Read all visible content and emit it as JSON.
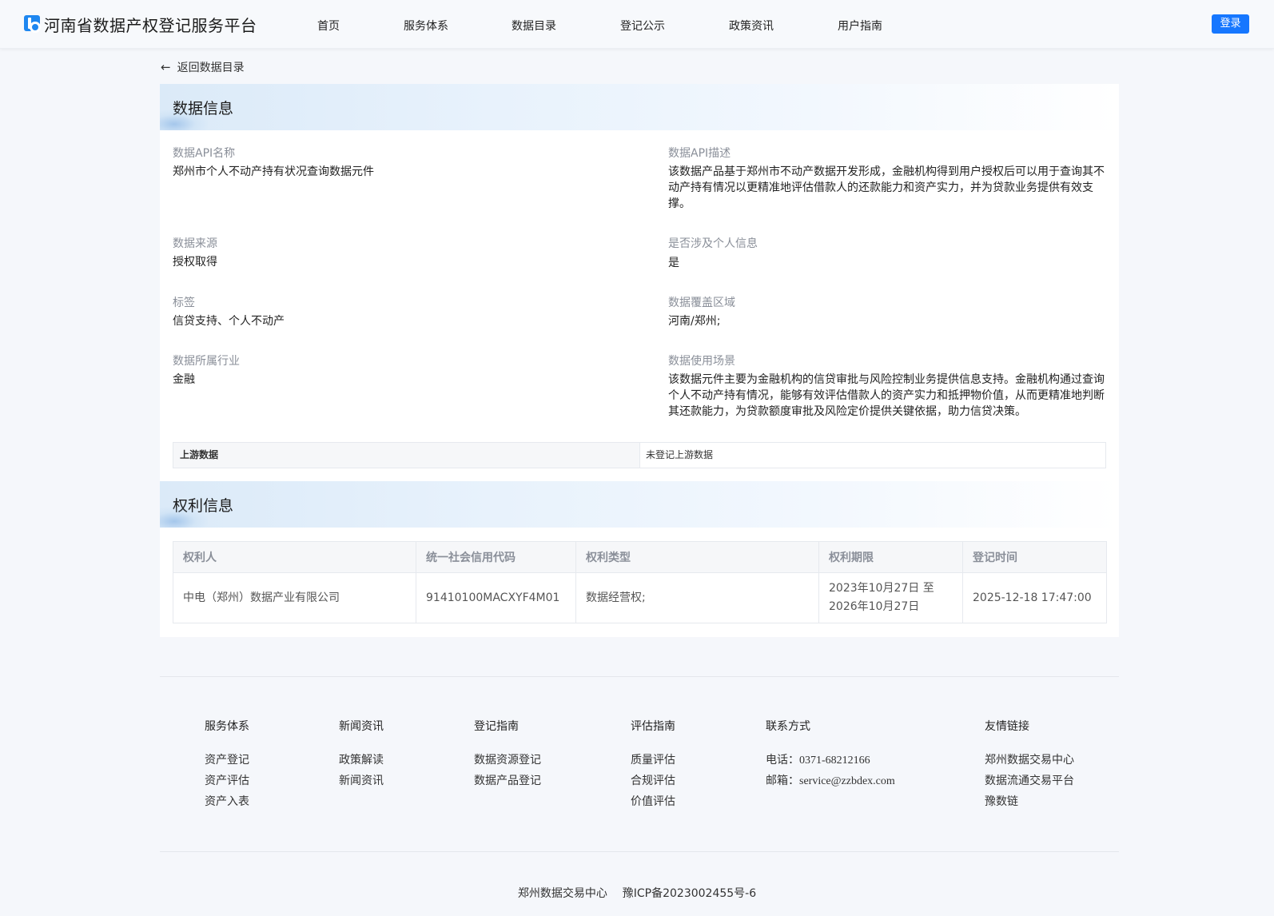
{
  "header": {
    "site_title": "河南省数据产权登记服务平台",
    "nav": [
      "首页",
      "服务体系",
      "数据目录",
      "登记公示",
      "政策资讯",
      "用户指南"
    ],
    "login_label": "登录"
  },
  "back_link": "返回数据目录",
  "data_info": {
    "section_title": "数据信息",
    "fields": [
      {
        "label": "数据API名称",
        "value": "郑州市个人不动产持有状况查询数据元件"
      },
      {
        "label": "数据API描述",
        "value": "该数据产品基于郑州市不动产数据开发形成，金融机构得到用户授权后可以用于查询其不动产持有情况以更精准地评估借款人的还款能力和资产实力，并为贷款业务提供有效支撑。"
      },
      {
        "label": "数据来源",
        "value": "授权取得"
      },
      {
        "label": "是否涉及个人信息",
        "value": "是"
      },
      {
        "label": "标签",
        "value": "信贷支持、个人不动产"
      },
      {
        "label": "数据覆盖区域",
        "value": "河南/郑州;"
      },
      {
        "label": "数据所属行业",
        "value": "金融"
      },
      {
        "label": "数据使用场景",
        "value": "该数据元件主要为金融机构的信贷审批与风险控制业务提供信息支持。金融机构通过查询个人不动产持有情况，能够有效评估借款人的资产实力和抵押物价值，从而更精准地判断其还款能力，为贷款额度审批及风险定价提供关键依据，助力信贷决策。"
      }
    ],
    "upstream_label": "上游数据",
    "upstream_value": "未登记上游数据"
  },
  "rights_info": {
    "section_title": "权利信息",
    "columns": [
      "权利人",
      "统一社会信用代码",
      "权利类型",
      "权利期限",
      "登记时间"
    ],
    "rows": [
      [
        "中电（郑州）数据产业有限公司",
        "91410100MACXYF4M01",
        "数据经营权;",
        "2023年10月27日 至 2026年10月27日",
        "2025-12-18 17:47:00"
      ]
    ]
  },
  "footer": {
    "columns": [
      {
        "title": "服务体系",
        "links": [
          "资产登记",
          "资产评估",
          "资产入表"
        ]
      },
      {
        "title": "新闻资讯",
        "links": [
          "政策解读",
          "新闻资讯"
        ]
      },
      {
        "title": "登记指南",
        "links": [
          "数据资源登记",
          "数据产品登记"
        ]
      },
      {
        "title": "评估指南",
        "links": [
          "质量评估",
          "合规评估",
          "价值评估"
        ]
      }
    ],
    "contact": {
      "title": "联系方式",
      "phone_label": "电话：",
      "phone": "0371-68212166",
      "email_label": "邮箱：",
      "email": "service@zzbdex.com"
    },
    "friend_links": {
      "title": "友情链接",
      "links": [
        "郑州数据交易中心",
        "数据流通交易平台",
        "豫数链"
      ]
    },
    "copyright_org": "郑州数据交易中心",
    "icp": "豫ICP备2023002455号-6"
  }
}
